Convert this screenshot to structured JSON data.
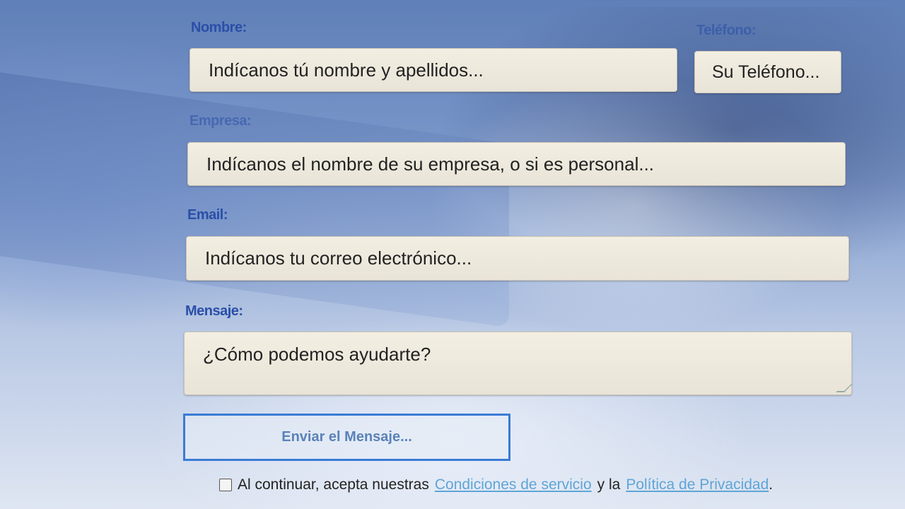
{
  "form": {
    "name": {
      "label": "Nombre:",
      "placeholder": "Indícanos tú nombre y apellidos..."
    },
    "phone": {
      "label": "Teléfono:",
      "placeholder": "Su Teléfono..."
    },
    "company": {
      "label": "Empresa:",
      "placeholder": "Indícanos el nombre de su empresa, o si es personal..."
    },
    "email": {
      "label": "Email:",
      "placeholder": "Indícanos tu correo electrónico..."
    },
    "message": {
      "label": "Mensaje:",
      "placeholder": "¿Cómo podemos ayudarte?"
    },
    "submit_label": "Enviar el Mensaje..."
  },
  "consent": {
    "text_before": "Al continuar, acepta nuestras",
    "terms_link": "Condiciones de servicio",
    "text_middle": "y la",
    "privacy_link": "Política de Privacidad",
    "text_after": "."
  },
  "colors": {
    "label": "#2a4fa8",
    "button_border": "#3a7bd5",
    "link": "#5fa5d6"
  }
}
